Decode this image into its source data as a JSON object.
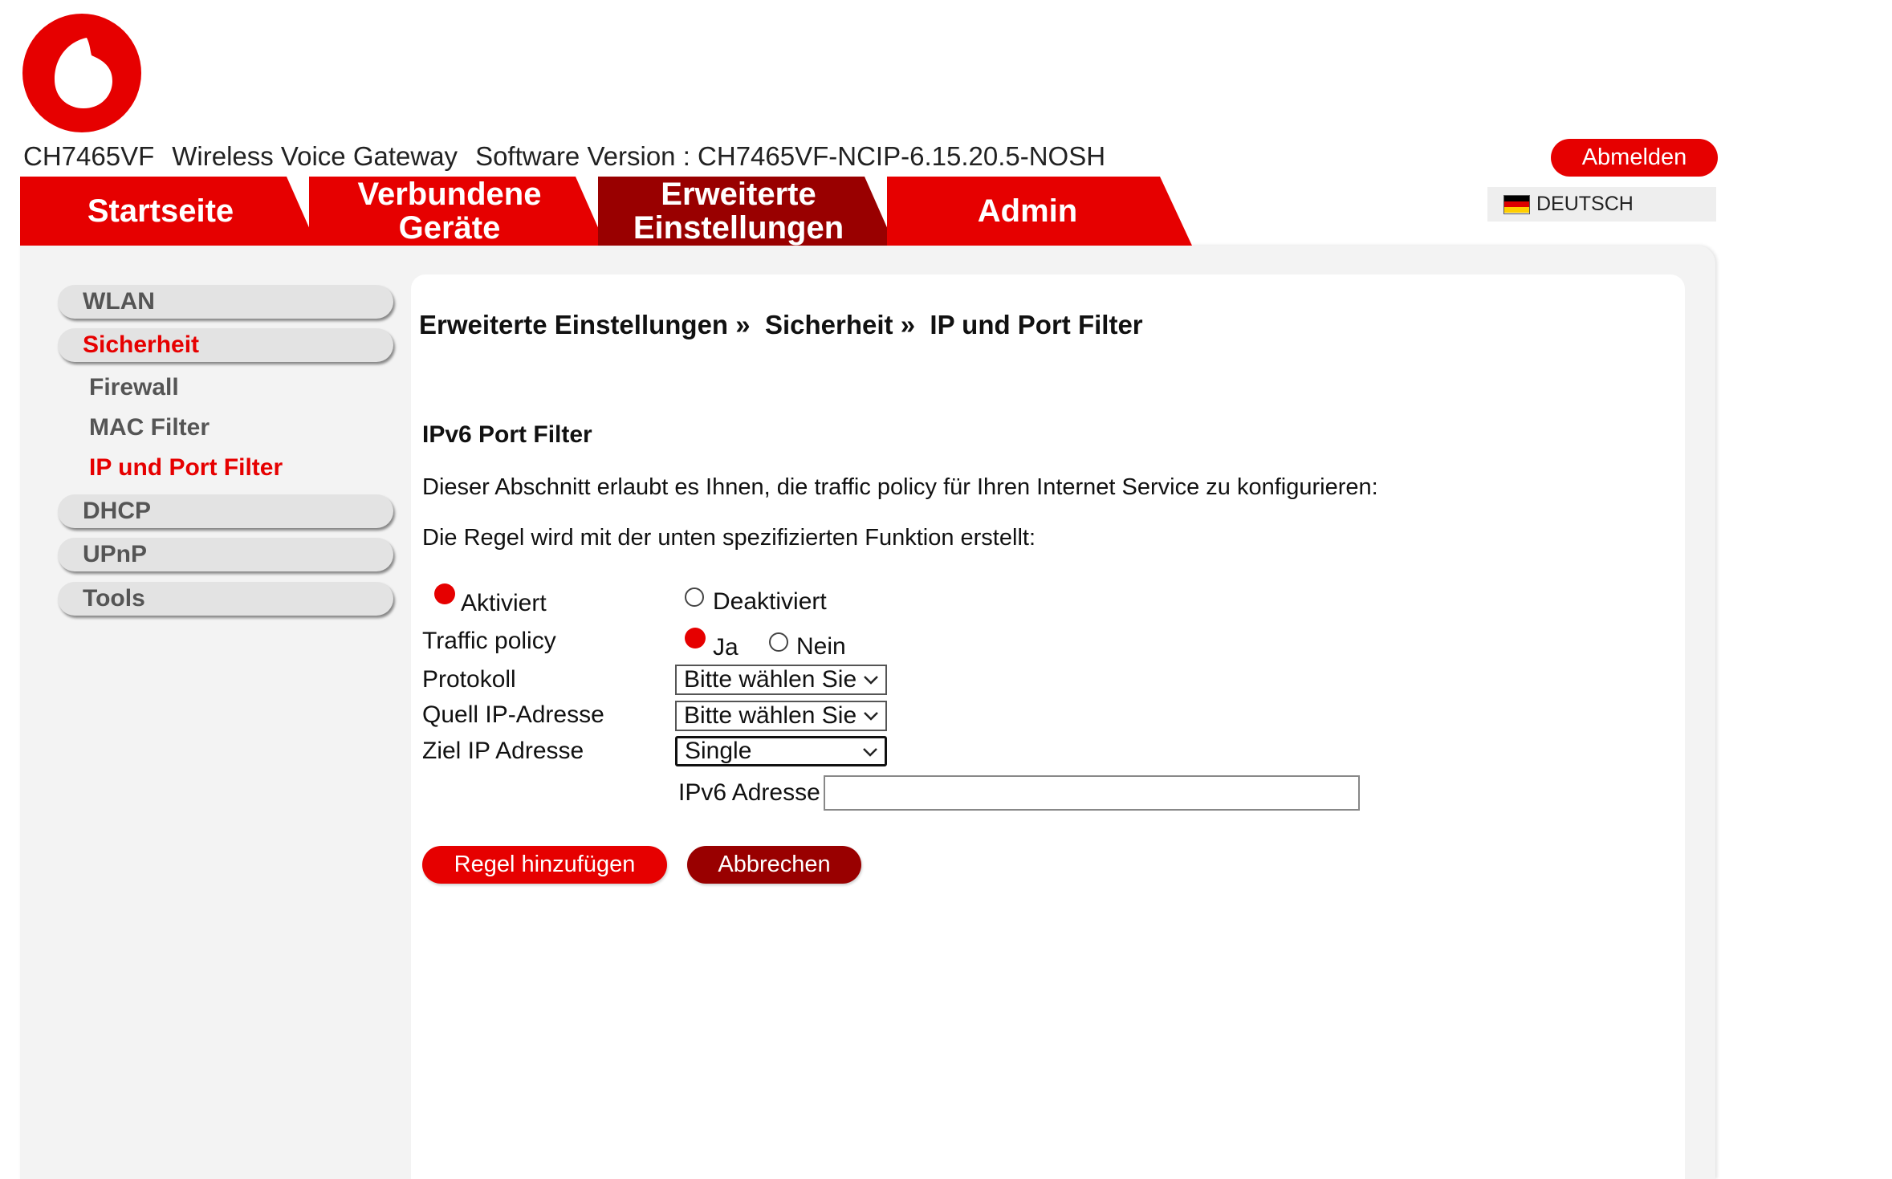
{
  "brand": {
    "accent": "#e60000",
    "accent_dark": "#990000",
    "logo": "vodafone-logo"
  },
  "header": {
    "model": "CH7465VF",
    "device_type": "Wireless Voice Gateway",
    "software_version": "Software Version : CH7465VF-NCIP-6.15.20.5-NOSH",
    "logout_label": "Abmelden",
    "language": "DEUTSCH",
    "language_icon": "german-flag-icon"
  },
  "tabs": [
    {
      "line1": "Startseite",
      "line2": ""
    },
    {
      "line1": "Verbundene",
      "line2": "Geräte"
    },
    {
      "line1": "Erweiterte",
      "line2": "Einstellungen",
      "active": true
    },
    {
      "line1": "Admin",
      "line2": ""
    }
  ],
  "sidebar": {
    "groups": [
      {
        "label": "WLAN"
      },
      {
        "label": "Sicherheit",
        "active": true
      },
      {
        "label": "DHCP"
      },
      {
        "label": "UPnP"
      },
      {
        "label": "Tools"
      }
    ],
    "sub_items": [
      {
        "label": "Firewall"
      },
      {
        "label": "MAC Filter"
      },
      {
        "label": "IP und Port Filter",
        "active": true
      }
    ]
  },
  "breadcrumb": {
    "part1": "Erweiterte Einstellungen",
    "part2": "Sicherheit",
    "part3": "IP und Port Filter",
    "separator": "»"
  },
  "form": {
    "title": "IPv6 Port Filter",
    "description": "Dieser Abschnitt erlaubt es Ihnen, die traffic policy für Ihren Internet Service zu konfigurieren:",
    "rule_note": "Die Regel wird mit der unten spezifizierten Funktion erstellt:",
    "status_options": {
      "enabled": "Aktiviert",
      "disabled": "Deaktiviert",
      "selected": "Aktiviert"
    },
    "traffic_policy": {
      "label": "Traffic policy",
      "yes": "Ja",
      "no": "Nein",
      "selected": "Ja"
    },
    "protocol": {
      "label": "Protokoll",
      "value": "Bitte wählen Sie"
    },
    "source_ip": {
      "label": "Quell IP-Adresse",
      "value": "Bitte wählen Sie"
    },
    "dest_ip": {
      "label": "Ziel IP Adresse",
      "value": "Single"
    },
    "ipv6_address": {
      "label": "IPv6 Adresse",
      "value": ""
    },
    "add_button": "Regel hinzufügen",
    "cancel_button": "Abbrechen"
  }
}
